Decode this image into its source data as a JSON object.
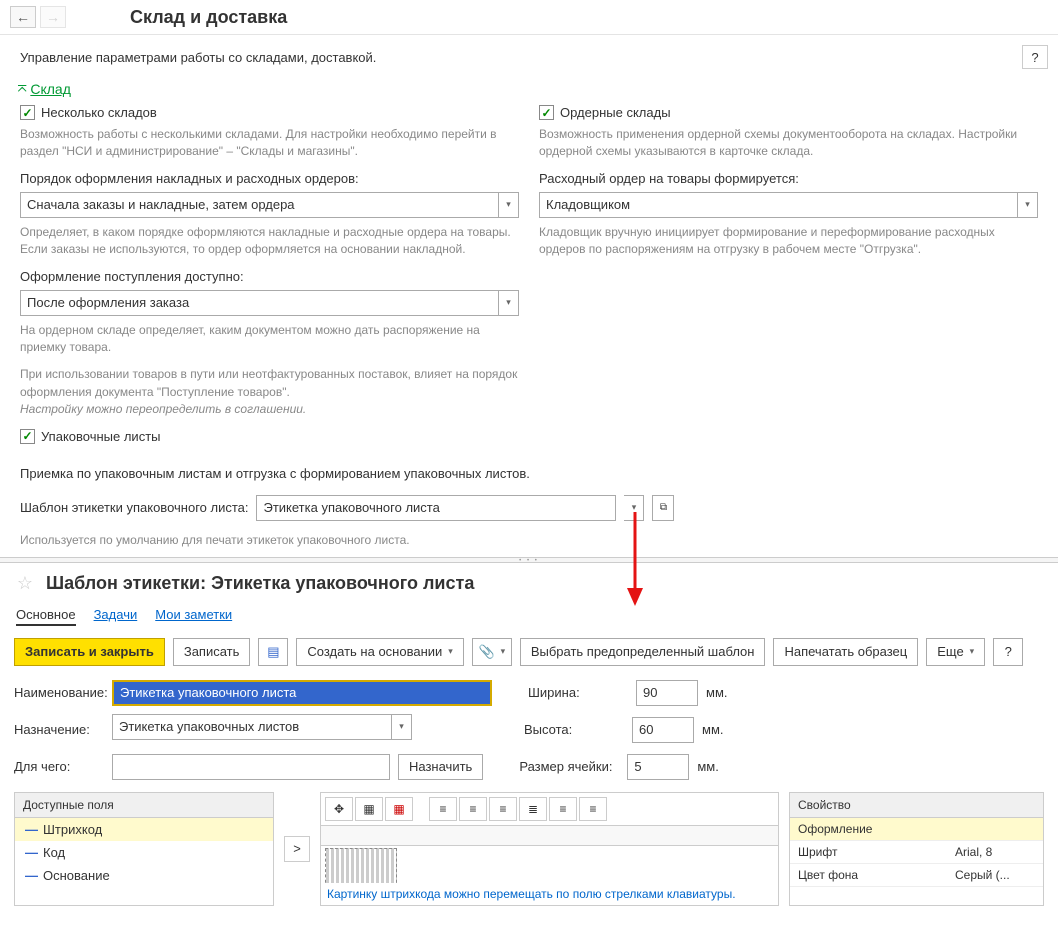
{
  "top": {
    "title": "Склад и доставка",
    "subtitle": "Управление параметрами работы со складами, доставкой.",
    "help": "?"
  },
  "section": {
    "title": "Склад"
  },
  "left_col": {
    "multi_warehouse_label": "Несколько складов",
    "multi_warehouse_desc": "Возможность работы с несколькими складами. Для настройки необходимо перейти в раздел \"НСИ и администрирование\" – \"Склады и магазины\".",
    "order_flow_label": "Порядок оформления накладных и расходных ордеров:",
    "order_flow_value": "Сначала заказы и накладные, затем ордера",
    "order_flow_desc": "Определяет, в каком порядке оформляются накладные и расходные ордера на товары. Если заказы не используются, то ордер оформляется на основании накладной.",
    "receipt_label": "Оформление поступления доступно:",
    "receipt_value": "После оформления заказа",
    "receipt_desc1": "На ордерном складе определяет, каким документом можно дать распоряжение на приемку товара.",
    "receipt_desc2": "При использовании товаров в пути или неотфактурованных поставок, влияет на порядок оформления документа \"Поступление товаров\".",
    "receipt_desc3": "Настройку можно переопределить в соглашении.",
    "packing_label": "Упаковочные листы"
  },
  "right_col": {
    "order_wh_label": "Ордерные склады",
    "order_wh_desc": "Возможность применения ордерной схемы документооборота на складах. Настройки ордерной схемы указываются в карточке склада.",
    "expense_label": "Расходный ордер на товары формируется:",
    "expense_value": "Кладовщиком",
    "expense_desc": "Кладовщик вручную инициирует формирование и переформирование расходных ордеров по распоряжениям на отгрузку в рабочем месте \"Отгрузка\"."
  },
  "packing_bottom": {
    "desc": "Приемка по упаковочным листам и отгрузка с формированием упаковочных листов.",
    "template_label": "Шаблон этикетки упаковочного листа:",
    "template_value": "Этикетка упаковочного листа",
    "template_desc": "Используется по умолчанию для печати этикеток упаковочного листа."
  },
  "lower": {
    "title": "Шаблон этикетки: Этикетка упаковочного листа",
    "tabs": {
      "main": "Основное",
      "tasks": "Задачи",
      "notes": "Мои заметки"
    },
    "toolbar": {
      "save_close": "Записать и закрыть",
      "save": "Записать",
      "create_based": "Создать на основании",
      "select_predef": "Выбрать предопределенный шаблон",
      "print_sample": "Напечатать образец",
      "more": "Еще",
      "help": "?"
    },
    "form": {
      "name_label": "Наименование:",
      "name_value": "Этикетка упаковочного листа",
      "purpose_label": "Назначение:",
      "purpose_value": "Этикетка упаковочных листов",
      "for_label": "Для чего:",
      "assign_btn": "Назначить",
      "width_label": "Ширина:",
      "width_value": "90",
      "width_unit": "мм.",
      "height_label": "Высота:",
      "height_value": "60",
      "height_unit": "мм.",
      "cell_label": "Размер ячейки:",
      "cell_value": "5",
      "cell_unit": "мм."
    },
    "fields_panel": {
      "header": "Доступные поля",
      "items": [
        "Штрихкод",
        "Код",
        "Основание"
      ]
    },
    "move_btn": ">",
    "design_hint": "Картинку штрихкода можно перемещать по полю стрелками клавиатуры.",
    "props_panel": {
      "header": "Свойство",
      "rows": [
        {
          "name": "Оформление",
          "val": ""
        },
        {
          "name": "Шрифт",
          "val": "Arial, 8"
        },
        {
          "name": "Цвет фона",
          "val": "Серый (..."
        }
      ]
    }
  }
}
